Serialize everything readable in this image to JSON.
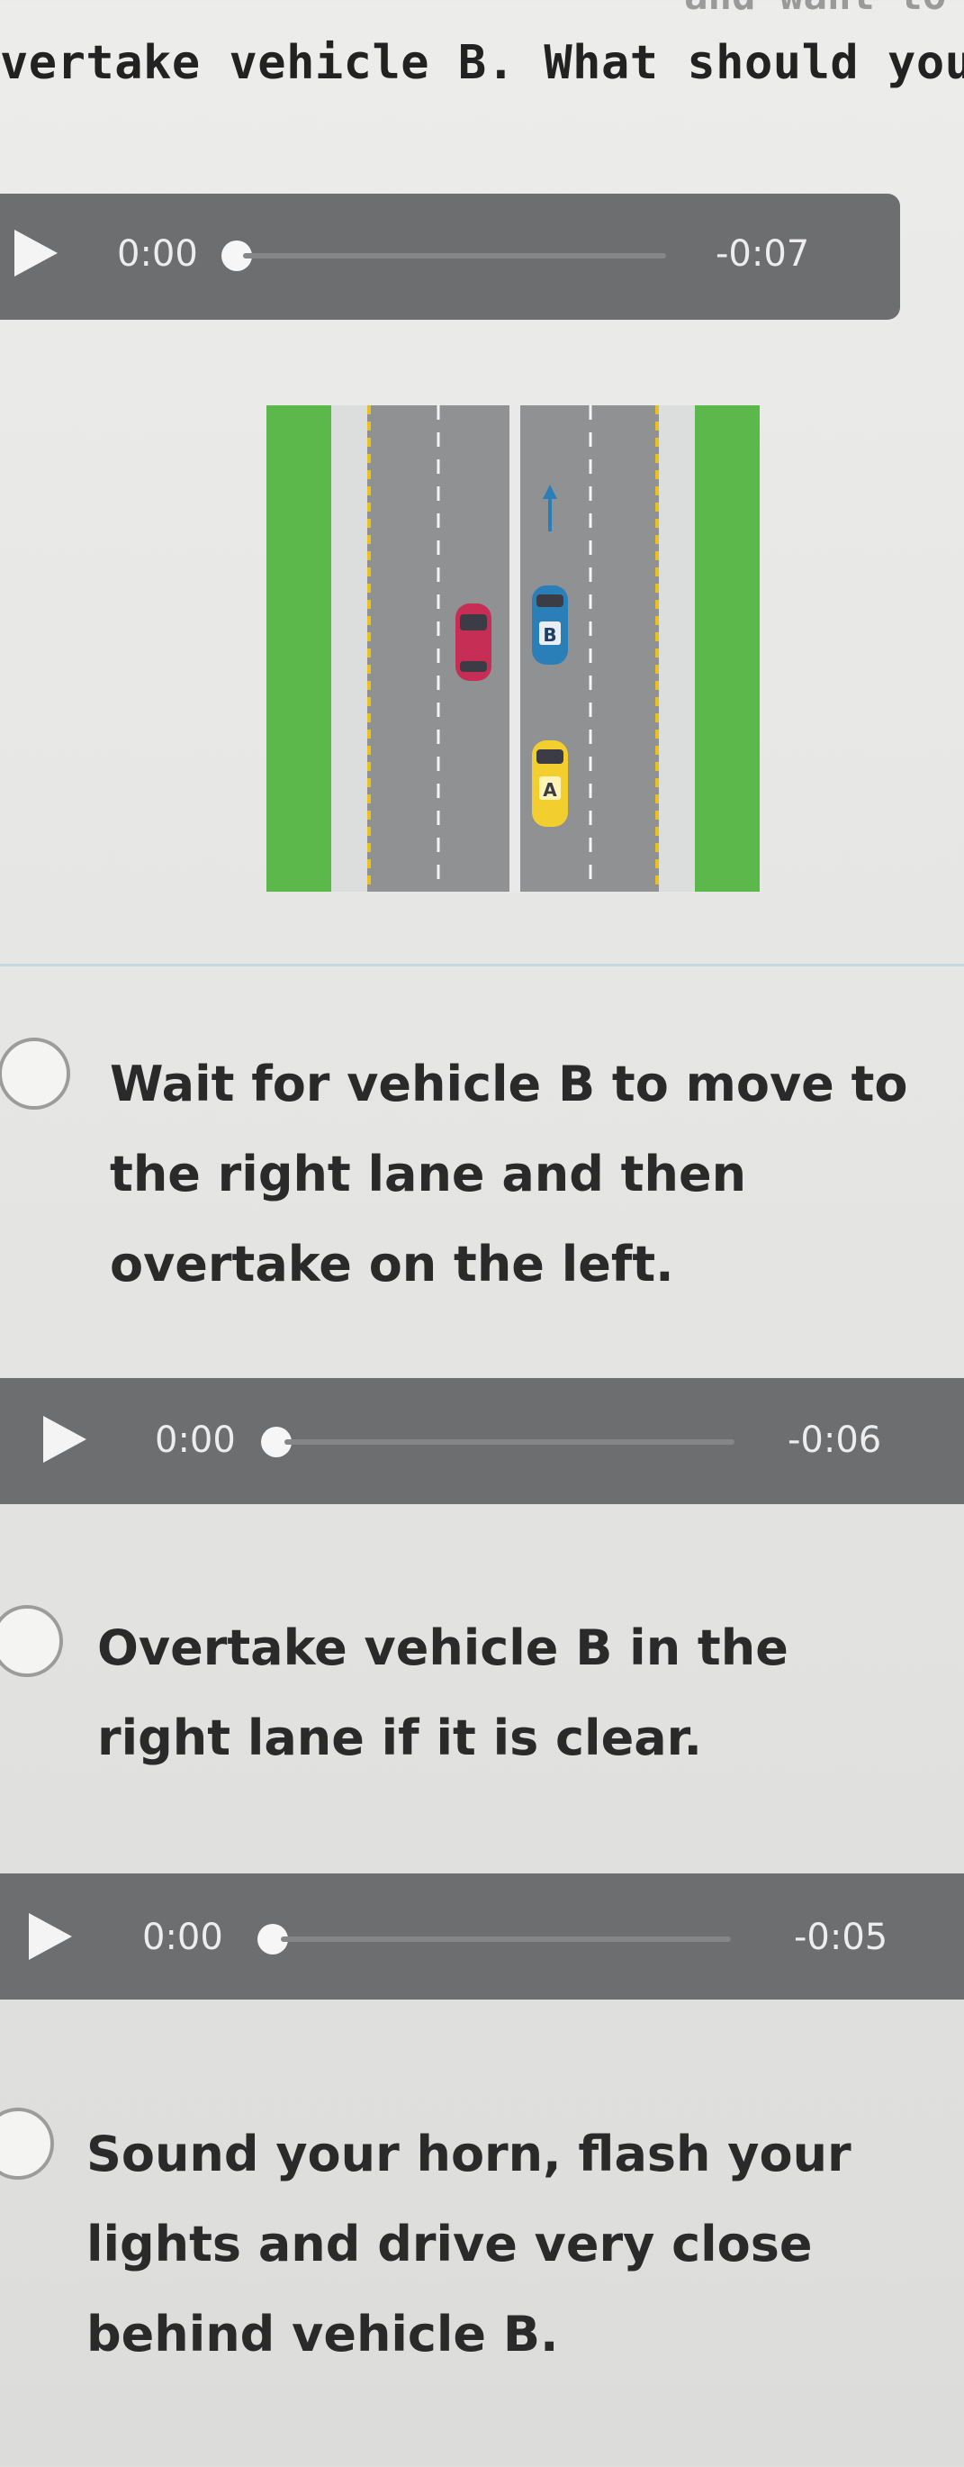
{
  "question": {
    "top_fragment": "and want to",
    "text": "vertake vehicle B. What should you"
  },
  "diagram": {
    "vehicle_labels": {
      "a": "A",
      "b": "B"
    },
    "colors": {
      "grass": "#5cb84a",
      "road": "#8f9193",
      "vehicle_a": "#f2cf2e",
      "vehicle_b": "#2a7fb8",
      "other_car": "#c72e55"
    }
  },
  "question_audio": {
    "current_time": "0:00",
    "remaining_time": "-0:07"
  },
  "options": [
    {
      "text_lines": [
        "Wait for vehicle B to move to",
        "the right lane and then",
        "overtake on the left."
      ],
      "audio": {
        "current_time": "0:00",
        "remaining_time": "-0:06"
      }
    },
    {
      "text_lines": [
        "Overtake vehicle B in the",
        "right lane if it is clear."
      ],
      "audio": {
        "current_time": "0:00",
        "remaining_time": "-0:05"
      }
    },
    {
      "text_lines": [
        "Sound your horn, flash your",
        "lights and drive very close",
        "behind vehicle B."
      ]
    }
  ]
}
